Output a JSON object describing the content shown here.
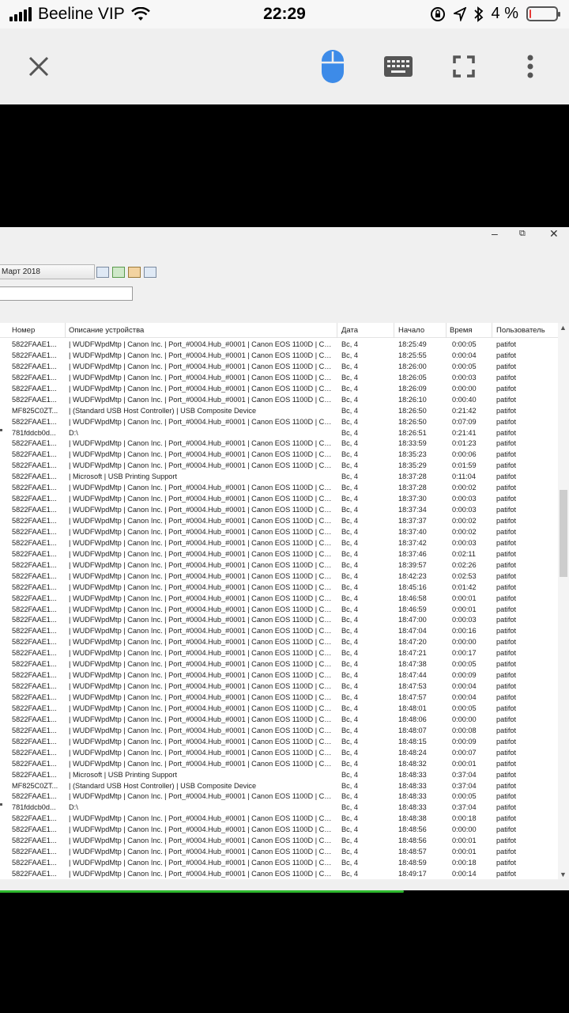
{
  "status_bar": {
    "carrier": "Beeline VIP",
    "time": "22:29",
    "battery": "4 %",
    "battery_level": 0.04,
    "battery_color": "#e53935"
  },
  "toolbar": {
    "close_icon": "close-icon",
    "mouse_icon": "mouse-icon",
    "keyboard_icon": "keyboard-icon",
    "fullscreen_icon": "fullscreen-icon",
    "more_icon": "more-vertical-icon",
    "accent_color": "#3d8be8"
  },
  "remote": {
    "window_controls": {
      "minimize": "–",
      "restore": "⧉",
      "close": "✕"
    },
    "date_value": "Март 2018",
    "filter_placeholder": "",
    "columns": [
      "Номер",
      "Описание устройства",
      "Дата",
      "Начало",
      "Время",
      "Пользователь"
    ],
    "rows": [
      [
        "5822FAAE1...",
        "| WUDFWpdMtp | Canon Inc. | Port_#0004.Hub_#0001 | Canon EOS 1100D | Ca...",
        "Вс, 4",
        "18:25:49",
        "0:00:05",
        "patifot"
      ],
      [
        "5822FAAE1...",
        "| WUDFWpdMtp | Canon Inc. | Port_#0004.Hub_#0001 | Canon EOS 1100D | Ca...",
        "Вс, 4",
        "18:25:55",
        "0:00:04",
        "patifot"
      ],
      [
        "5822FAAE1...",
        "| WUDFWpdMtp | Canon Inc. | Port_#0004.Hub_#0001 | Canon EOS 1100D | Ca...",
        "Вс, 4",
        "18:26:00",
        "0:00:05",
        "patifot"
      ],
      [
        "5822FAAE1...",
        "| WUDFWpdMtp | Canon Inc. | Port_#0004.Hub_#0001 | Canon EOS 1100D | Ca...",
        "Вс, 4",
        "18:26:05",
        "0:00:03",
        "patifot"
      ],
      [
        "5822FAAE1...",
        "| WUDFWpdMtp | Canon Inc. | Port_#0004.Hub_#0001 | Canon EOS 1100D | Ca...",
        "Вс, 4",
        "18:26:09",
        "0:00:00",
        "patifot"
      ],
      [
        "5822FAAE1...",
        "| WUDFWpdMtp | Canon Inc. | Port_#0004.Hub_#0001 | Canon EOS 1100D | Ca...",
        "Вс, 4",
        "18:26:10",
        "0:00:40",
        "patifot"
      ],
      [
        "MF825C0ZT...",
        "| (Standard USB Host Controller) | USB Composite Device",
        "Вс, 4",
        "18:26:50",
        "0:21:42",
        "patifot"
      ],
      [
        "5822FAAE1...",
        "| WUDFWpdMtp | Canon Inc. | Port_#0004.Hub_#0001 | Canon EOS 1100D | Ca...",
        "Вс, 4",
        "18:26:50",
        "0:07:09",
        "patifot"
      ],
      [
        "781fddcb0d...",
        "D:\\",
        "Вс, 4",
        "18:26:51",
        "0:21:41",
        "patifot"
      ],
      [
        "5822FAAE1...",
        "| WUDFWpdMtp | Canon Inc. | Port_#0004.Hub_#0001 | Canon EOS 1100D | Ca...",
        "Вс, 4",
        "18:33:59",
        "0:01:23",
        "patifot"
      ],
      [
        "5822FAAE1...",
        "| WUDFWpdMtp | Canon Inc. | Port_#0004.Hub_#0001 | Canon EOS 1100D | Ca...",
        "Вс, 4",
        "18:35:23",
        "0:00:06",
        "patifot"
      ],
      [
        "5822FAAE1...",
        "| WUDFWpdMtp | Canon Inc. | Port_#0004.Hub_#0001 | Canon EOS 1100D | Ca...",
        "Вс, 4",
        "18:35:29",
        "0:01:59",
        "patifot"
      ],
      [
        "5822FAAE1...",
        "| Microsoft | USB Printing Support",
        "Вс, 4",
        "18:37:28",
        "0:11:04",
        "patifot"
      ],
      [
        "5822FAAE1...",
        "| WUDFWpdMtp | Canon Inc. | Port_#0004.Hub_#0001 | Canon EOS 1100D | Ca...",
        "Вс, 4",
        "18:37:28",
        "0:00:02",
        "patifot"
      ],
      [
        "5822FAAE1...",
        "| WUDFWpdMtp | Canon Inc. | Port_#0004.Hub_#0001 | Canon EOS 1100D | Ca...",
        "Вс, 4",
        "18:37:30",
        "0:00:03",
        "patifot"
      ],
      [
        "5822FAAE1...",
        "| WUDFWpdMtp | Canon Inc. | Port_#0004.Hub_#0001 | Canon EOS 1100D | Ca...",
        "Вс, 4",
        "18:37:34",
        "0:00:03",
        "patifot"
      ],
      [
        "5822FAAE1...",
        "| WUDFWpdMtp | Canon Inc. | Port_#0004.Hub_#0001 | Canon EOS 1100D | Ca...",
        "Вс, 4",
        "18:37:37",
        "0:00:02",
        "patifot"
      ],
      [
        "5822FAAE1...",
        "| WUDFWpdMtp | Canon Inc. | Port_#0004.Hub_#0001 | Canon EOS 1100D | Ca...",
        "Вс, 4",
        "18:37:40",
        "0:00:02",
        "patifot"
      ],
      [
        "5822FAAE1...",
        "| WUDFWpdMtp | Canon Inc. | Port_#0004.Hub_#0001 | Canon EOS 1100D | Ca...",
        "Вс, 4",
        "18:37:42",
        "0:00:03",
        "patifot"
      ],
      [
        "5822FAAE1...",
        "| WUDFWpdMtp | Canon Inc. | Port_#0004.Hub_#0001 | Canon EOS 1100D | Ca...",
        "Вс, 4",
        "18:37:46",
        "0:02:11",
        "patifot"
      ],
      [
        "5822FAAE1...",
        "| WUDFWpdMtp | Canon Inc. | Port_#0004.Hub_#0001 | Canon EOS 1100D | Ca...",
        "Вс, 4",
        "18:39:57",
        "0:02:26",
        "patifot"
      ],
      [
        "5822FAAE1...",
        "| WUDFWpdMtp | Canon Inc. | Port_#0004.Hub_#0001 | Canon EOS 1100D | Ca...",
        "Вс, 4",
        "18:42:23",
        "0:02:53",
        "patifot"
      ],
      [
        "5822FAAE1...",
        "| WUDFWpdMtp | Canon Inc. | Port_#0004.Hub_#0001 | Canon EOS 1100D | Ca...",
        "Вс, 4",
        "18:45:16",
        "0:01:42",
        "patifot"
      ],
      [
        "5822FAAE1...",
        "| WUDFWpdMtp | Canon Inc. | Port_#0004.Hub_#0001 | Canon EOS 1100D | Ca...",
        "Вс, 4",
        "18:46:58",
        "0:00:01",
        "patifot"
      ],
      [
        "5822FAAE1...",
        "| WUDFWpdMtp | Canon Inc. | Port_#0004.Hub_#0001 | Canon EOS 1100D | Ca...",
        "Вс, 4",
        "18:46:59",
        "0:00:01",
        "patifot"
      ],
      [
        "5822FAAE1...",
        "| WUDFWpdMtp | Canon Inc. | Port_#0004.Hub_#0001 | Canon EOS 1100D | Ca...",
        "Вс, 4",
        "18:47:00",
        "0:00:03",
        "patifot"
      ],
      [
        "5822FAAE1...",
        "| WUDFWpdMtp | Canon Inc. | Port_#0004.Hub_#0001 | Canon EOS 1100D | Ca...",
        "Вс, 4",
        "18:47:04",
        "0:00:16",
        "patifot"
      ],
      [
        "5822FAAE1...",
        "| WUDFWpdMtp | Canon Inc. | Port_#0004.Hub_#0001 | Canon EOS 1100D | Ca...",
        "Вс, 4",
        "18:47:20",
        "0:00:00",
        "patifot"
      ],
      [
        "5822FAAE1...",
        "| WUDFWpdMtp | Canon Inc. | Port_#0004.Hub_#0001 | Canon EOS 1100D | Ca...",
        "Вс, 4",
        "18:47:21",
        "0:00:17",
        "patifot"
      ],
      [
        "5822FAAE1...",
        "| WUDFWpdMtp | Canon Inc. | Port_#0004.Hub_#0001 | Canon EOS 1100D | Ca...",
        "Вс, 4",
        "18:47:38",
        "0:00:05",
        "patifot"
      ],
      [
        "5822FAAE1...",
        "| WUDFWpdMtp | Canon Inc. | Port_#0004.Hub_#0001 | Canon EOS 1100D | Ca...",
        "Вс, 4",
        "18:47:44",
        "0:00:09",
        "patifot"
      ],
      [
        "5822FAAE1...",
        "| WUDFWpdMtp | Canon Inc. | Port_#0004.Hub_#0001 | Canon EOS 1100D | Ca...",
        "Вс, 4",
        "18:47:53",
        "0:00:04",
        "patifot"
      ],
      [
        "5822FAAE1...",
        "| WUDFWpdMtp | Canon Inc. | Port_#0004.Hub_#0001 | Canon EOS 1100D | Ca...",
        "Вс, 4",
        "18:47:57",
        "0:00:04",
        "patifot"
      ],
      [
        "5822FAAE1...",
        "| WUDFWpdMtp | Canon Inc. | Port_#0004.Hub_#0001 | Canon EOS 1100D | Ca...",
        "Вс, 4",
        "18:48:01",
        "0:00:05",
        "patifot"
      ],
      [
        "5822FAAE1...",
        "| WUDFWpdMtp | Canon Inc. | Port_#0004.Hub_#0001 | Canon EOS 1100D | Ca...",
        "Вс, 4",
        "18:48:06",
        "0:00:00",
        "patifot"
      ],
      [
        "5822FAAE1...",
        "| WUDFWpdMtp | Canon Inc. | Port_#0004.Hub_#0001 | Canon EOS 1100D | Ca...",
        "Вс, 4",
        "18:48:07",
        "0:00:08",
        "patifot"
      ],
      [
        "5822FAAE1...",
        "| WUDFWpdMtp | Canon Inc. | Port_#0004.Hub_#0001 | Canon EOS 1100D | Ca...",
        "Вс, 4",
        "18:48:15",
        "0:00:09",
        "patifot"
      ],
      [
        "5822FAAE1...",
        "| WUDFWpdMtp | Canon Inc. | Port_#0004.Hub_#0001 | Canon EOS 1100D | Ca...",
        "Вс, 4",
        "18:48:24",
        "0:00:07",
        "patifot"
      ],
      [
        "5822FAAE1...",
        "| WUDFWpdMtp | Canon Inc. | Port_#0004.Hub_#0001 | Canon EOS 1100D | Ca...",
        "Вс, 4",
        "18:48:32",
        "0:00:01",
        "patifot"
      ],
      [
        "5822FAAE1...",
        "| Microsoft | USB Printing Support",
        "Вс, 4",
        "18:48:33",
        "0:37:04",
        "patifot"
      ],
      [
        "MF825C0ZT...",
        "| (Standard USB Host Controller) | USB Composite Device",
        "Вс, 4",
        "18:48:33",
        "0:37:04",
        "patifot"
      ],
      [
        "5822FAAE1...",
        "| WUDFWpdMtp | Canon Inc. | Port_#0004.Hub_#0001 | Canon EOS 1100D | Ca...",
        "Вс, 4",
        "18:48:33",
        "0:00:05",
        "patifot"
      ],
      [
        "781fddcb0d...",
        "D:\\",
        "Вс, 4",
        "18:48:33",
        "0:37:04",
        "patifot"
      ],
      [
        "5822FAAE1...",
        "| WUDFWpdMtp | Canon Inc. | Port_#0004.Hub_#0001 | Canon EOS 1100D | Ca...",
        "Вс, 4",
        "18:48:38",
        "0:00:18",
        "patifot"
      ],
      [
        "5822FAAE1...",
        "| WUDFWpdMtp | Canon Inc. | Port_#0004.Hub_#0001 | Canon EOS 1100D | Ca...",
        "Вс, 4",
        "18:48:56",
        "0:00:00",
        "patifot"
      ],
      [
        "5822FAAE1...",
        "| WUDFWpdMtp | Canon Inc. | Port_#0004.Hub_#0001 | Canon EOS 1100D | Ca...",
        "Вс, 4",
        "18:48:56",
        "0:00:01",
        "patifot"
      ],
      [
        "5822FAAE1...",
        "| WUDFWpdMtp | Canon Inc. | Port_#0004.Hub_#0001 | Canon EOS 1100D | Ca...",
        "Вс, 4",
        "18:48:57",
        "0:00:01",
        "patifot"
      ],
      [
        "5822FAAE1...",
        "| WUDFWpdMtp | Canon Inc. | Port_#0004.Hub_#0001 | Canon EOS 1100D | Ca...",
        "Вс, 4",
        "18:48:59",
        "0:00:18",
        "patifot"
      ],
      [
        "5822FAAE1...",
        "| WUDFWpdMtp | Canon Inc. | Port_#0004.Hub_#0001 | Canon EOS 1100D | Ca...",
        "Вс, 4",
        "18:49:17",
        "0:00:14",
        "patifot"
      ]
    ],
    "marked_rows": [
      8,
      42
    ],
    "scroll_position": 0.35,
    "connection_progress": 0.71,
    "progress_color": "#2eb82e"
  }
}
